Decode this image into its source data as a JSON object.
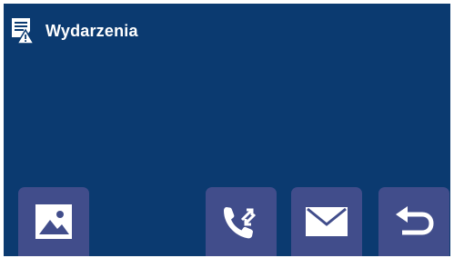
{
  "header": {
    "title": "Wydarzenia",
    "icon": "events-alert-icon"
  },
  "toolbar": {
    "buttons": [
      {
        "name": "gallery-button",
        "icon": "image-icon"
      },
      {
        "name": "call-log-button",
        "icon": "call-transfer-icon"
      },
      {
        "name": "message-button",
        "icon": "envelope-icon"
      },
      {
        "name": "back-button",
        "icon": "back-arrow-icon"
      }
    ]
  },
  "colors": {
    "background": "#0b3a70",
    "button": "#414d8b",
    "foreground": "#ffffff"
  }
}
